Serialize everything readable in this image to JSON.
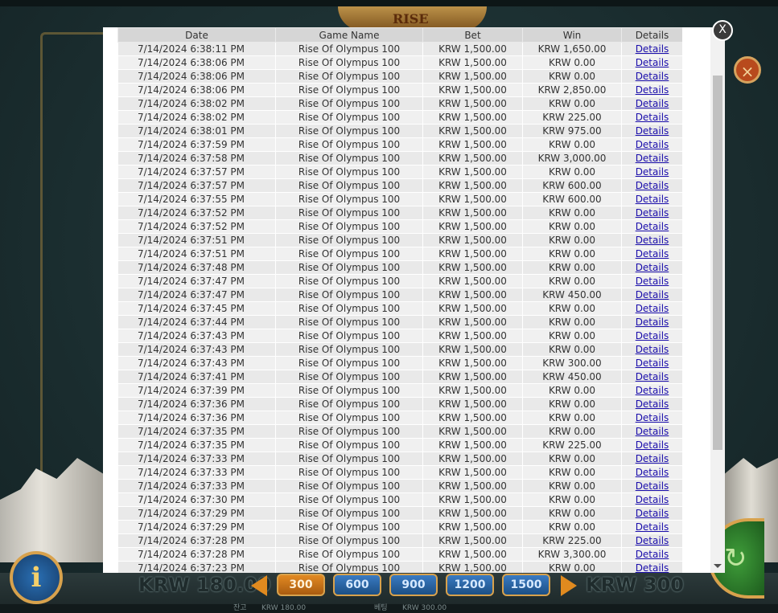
{
  "game": {
    "logo_text": "RISE",
    "close_icon": "×",
    "info_label": "i",
    "total_bet_left": "KRW 180.00",
    "total_bet_right": "KRW 300",
    "bet_options": [
      "300",
      "600",
      "900",
      "1200",
      "1500"
    ],
    "footer": [
      "잔고",
      "KRW 180.00",
      "베팅",
      "KRW 300.00"
    ]
  },
  "modal": {
    "close_label": "X",
    "headers": {
      "date": "Date",
      "game": "Game Name",
      "bet": "Bet",
      "win": "Win",
      "details": "Details"
    },
    "rows": [
      {
        "date": "7/14/2024 6:38:11 PM",
        "game": "Rise Of Olympus 100",
        "bet": "KRW 1,500.00",
        "win": "KRW 1,650.00",
        "details": "Details"
      },
      {
        "date": "7/14/2024 6:38:06 PM",
        "game": "Rise Of Olympus 100",
        "bet": "KRW 1,500.00",
        "win": "KRW 0.00",
        "details": "Details"
      },
      {
        "date": "7/14/2024 6:38:06 PM",
        "game": "Rise Of Olympus 100",
        "bet": "KRW 1,500.00",
        "win": "KRW 0.00",
        "details": "Details"
      },
      {
        "date": "7/14/2024 6:38:06 PM",
        "game": "Rise Of Olympus 100",
        "bet": "KRW 1,500.00",
        "win": "KRW 2,850.00",
        "details": "Details"
      },
      {
        "date": "7/14/2024 6:38:02 PM",
        "game": "Rise Of Olympus 100",
        "bet": "KRW 1,500.00",
        "win": "KRW 0.00",
        "details": "Details"
      },
      {
        "date": "7/14/2024 6:38:02 PM",
        "game": "Rise Of Olympus 100",
        "bet": "KRW 1,500.00",
        "win": "KRW 225.00",
        "details": "Details"
      },
      {
        "date": "7/14/2024 6:38:01 PM",
        "game": "Rise Of Olympus 100",
        "bet": "KRW 1,500.00",
        "win": "KRW 975.00",
        "details": "Details"
      },
      {
        "date": "7/14/2024 6:37:59 PM",
        "game": "Rise Of Olympus 100",
        "bet": "KRW 1,500.00",
        "win": "KRW 0.00",
        "details": "Details"
      },
      {
        "date": "7/14/2024 6:37:58 PM",
        "game": "Rise Of Olympus 100",
        "bet": "KRW 1,500.00",
        "win": "KRW 3,000.00",
        "details": "Details"
      },
      {
        "date": "7/14/2024 6:37:57 PM",
        "game": "Rise Of Olympus 100",
        "bet": "KRW 1,500.00",
        "win": "KRW 0.00",
        "details": "Details"
      },
      {
        "date": "7/14/2024 6:37:57 PM",
        "game": "Rise Of Olympus 100",
        "bet": "KRW 1,500.00",
        "win": "KRW 600.00",
        "details": "Details"
      },
      {
        "date": "7/14/2024 6:37:55 PM",
        "game": "Rise Of Olympus 100",
        "bet": "KRW 1,500.00",
        "win": "KRW 600.00",
        "details": "Details"
      },
      {
        "date": "7/14/2024 6:37:52 PM",
        "game": "Rise Of Olympus 100",
        "bet": "KRW 1,500.00",
        "win": "KRW 0.00",
        "details": "Details"
      },
      {
        "date": "7/14/2024 6:37:52 PM",
        "game": "Rise Of Olympus 100",
        "bet": "KRW 1,500.00",
        "win": "KRW 0.00",
        "details": "Details"
      },
      {
        "date": "7/14/2024 6:37:51 PM",
        "game": "Rise Of Olympus 100",
        "bet": "KRW 1,500.00",
        "win": "KRW 0.00",
        "details": "Details"
      },
      {
        "date": "7/14/2024 6:37:51 PM",
        "game": "Rise Of Olympus 100",
        "bet": "KRW 1,500.00",
        "win": "KRW 0.00",
        "details": "Details"
      },
      {
        "date": "7/14/2024 6:37:48 PM",
        "game": "Rise Of Olympus 100",
        "bet": "KRW 1,500.00",
        "win": "KRW 0.00",
        "details": "Details"
      },
      {
        "date": "7/14/2024 6:37:47 PM",
        "game": "Rise Of Olympus 100",
        "bet": "KRW 1,500.00",
        "win": "KRW 0.00",
        "details": "Details"
      },
      {
        "date": "7/14/2024 6:37:47 PM",
        "game": "Rise Of Olympus 100",
        "bet": "KRW 1,500.00",
        "win": "KRW 450.00",
        "details": "Details"
      },
      {
        "date": "7/14/2024 6:37:45 PM",
        "game": "Rise Of Olympus 100",
        "bet": "KRW 1,500.00",
        "win": "KRW 0.00",
        "details": "Details"
      },
      {
        "date": "7/14/2024 6:37:44 PM",
        "game": "Rise Of Olympus 100",
        "bet": "KRW 1,500.00",
        "win": "KRW 0.00",
        "details": "Details"
      },
      {
        "date": "7/14/2024 6:37:43 PM",
        "game": "Rise Of Olympus 100",
        "bet": "KRW 1,500.00",
        "win": "KRW 0.00",
        "details": "Details"
      },
      {
        "date": "7/14/2024 6:37:43 PM",
        "game": "Rise Of Olympus 100",
        "bet": "KRW 1,500.00",
        "win": "KRW 0.00",
        "details": "Details"
      },
      {
        "date": "7/14/2024 6:37:43 PM",
        "game": "Rise Of Olympus 100",
        "bet": "KRW 1,500.00",
        "win": "KRW 300.00",
        "details": "Details"
      },
      {
        "date": "7/14/2024 6:37:41 PM",
        "game": "Rise Of Olympus 100",
        "bet": "KRW 1,500.00",
        "win": "KRW 450.00",
        "details": "Details"
      },
      {
        "date": "7/14/2024 6:37:39 PM",
        "game": "Rise Of Olympus 100",
        "bet": "KRW 1,500.00",
        "win": "KRW 0.00",
        "details": "Details"
      },
      {
        "date": "7/14/2024 6:37:36 PM",
        "game": "Rise Of Olympus 100",
        "bet": "KRW 1,500.00",
        "win": "KRW 0.00",
        "details": "Details"
      },
      {
        "date": "7/14/2024 6:37:36 PM",
        "game": "Rise Of Olympus 100",
        "bet": "KRW 1,500.00",
        "win": "KRW 0.00",
        "details": "Details"
      },
      {
        "date": "7/14/2024 6:37:35 PM",
        "game": "Rise Of Olympus 100",
        "bet": "KRW 1,500.00",
        "win": "KRW 0.00",
        "details": "Details"
      },
      {
        "date": "7/14/2024 6:37:35 PM",
        "game": "Rise Of Olympus 100",
        "bet": "KRW 1,500.00",
        "win": "KRW 225.00",
        "details": "Details"
      },
      {
        "date": "7/14/2024 6:37:33 PM",
        "game": "Rise Of Olympus 100",
        "bet": "KRW 1,500.00",
        "win": "KRW 0.00",
        "details": "Details"
      },
      {
        "date": "7/14/2024 6:37:33 PM",
        "game": "Rise Of Olympus 100",
        "bet": "KRW 1,500.00",
        "win": "KRW 0.00",
        "details": "Details"
      },
      {
        "date": "7/14/2024 6:37:33 PM",
        "game": "Rise Of Olympus 100",
        "bet": "KRW 1,500.00",
        "win": "KRW 0.00",
        "details": "Details"
      },
      {
        "date": "7/14/2024 6:37:30 PM",
        "game": "Rise Of Olympus 100",
        "bet": "KRW 1,500.00",
        "win": "KRW 0.00",
        "details": "Details"
      },
      {
        "date": "7/14/2024 6:37:29 PM",
        "game": "Rise Of Olympus 100",
        "bet": "KRW 1,500.00",
        "win": "KRW 0.00",
        "details": "Details"
      },
      {
        "date": "7/14/2024 6:37:29 PM",
        "game": "Rise Of Olympus 100",
        "bet": "KRW 1,500.00",
        "win": "KRW 0.00",
        "details": "Details"
      },
      {
        "date": "7/14/2024 6:37:28 PM",
        "game": "Rise Of Olympus 100",
        "bet": "KRW 1,500.00",
        "win": "KRW 225.00",
        "details": "Details"
      },
      {
        "date": "7/14/2024 6:37:28 PM",
        "game": "Rise Of Olympus 100",
        "bet": "KRW 1,500.00",
        "win": "KRW 3,300.00",
        "details": "Details"
      },
      {
        "date": "7/14/2024 6:37:23 PM",
        "game": "Rise Of Olympus 100",
        "bet": "KRW 1,500.00",
        "win": "KRW 0.00",
        "details": "Details"
      }
    ]
  }
}
